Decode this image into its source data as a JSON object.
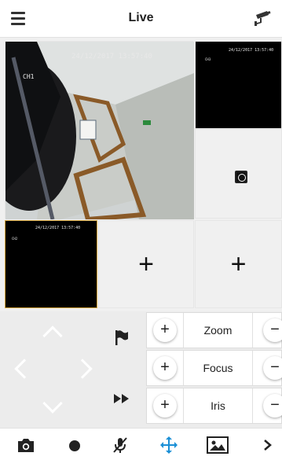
{
  "header": {
    "title": "Live"
  },
  "tiles": {
    "main_timestamp": "24/12/2017 13:57:40",
    "main_channel": "CH1",
    "tile2_timestamp": "24/12/2017 13:57:40",
    "tile2_channel": "CH3",
    "tile4_timestamp": "24/12/2017 13:57:40",
    "tile4_channel": "CH2"
  },
  "ptz": {
    "controls": [
      {
        "label": "Zoom",
        "plus": "+",
        "minus": "−"
      },
      {
        "label": "Focus",
        "plus": "+",
        "minus": "−"
      },
      {
        "label": "Iris",
        "plus": "+",
        "minus": "−"
      }
    ]
  },
  "toolbar": {
    "icons": [
      "camera-icon",
      "record-icon",
      "mic-off-icon",
      "move-icon",
      "image-icon",
      "chevron-right-icon"
    ],
    "accent": "#1a8fd6"
  },
  "colors": {
    "selected_border": "#d4a43b",
    "panel_bg": "#ececec"
  }
}
